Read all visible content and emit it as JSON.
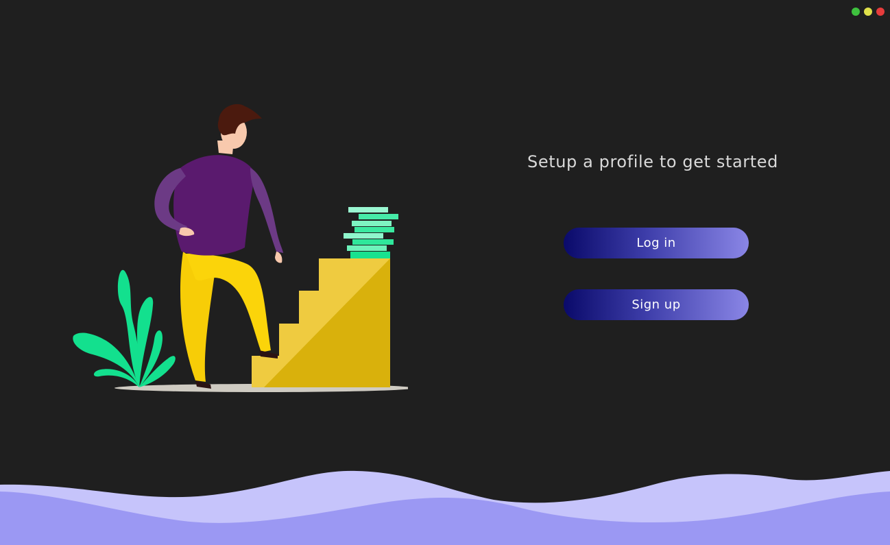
{
  "window": {
    "controls": [
      {
        "name": "maximize",
        "color": "#3ec13e"
      },
      {
        "name": "minimize",
        "color": "#e0e04a"
      },
      {
        "name": "close",
        "color": "#e63c3c"
      }
    ]
  },
  "main": {
    "headline": "Setup a profile to get started",
    "login_label": "Log in",
    "signup_label": "Sign up"
  },
  "theme": {
    "background": "#1f1f1f",
    "button_gradient_start": "#0a0a6a",
    "button_gradient_end": "#8a86e6",
    "wave_light": "#c6c4fb",
    "wave_dark": "#9b98f3"
  }
}
